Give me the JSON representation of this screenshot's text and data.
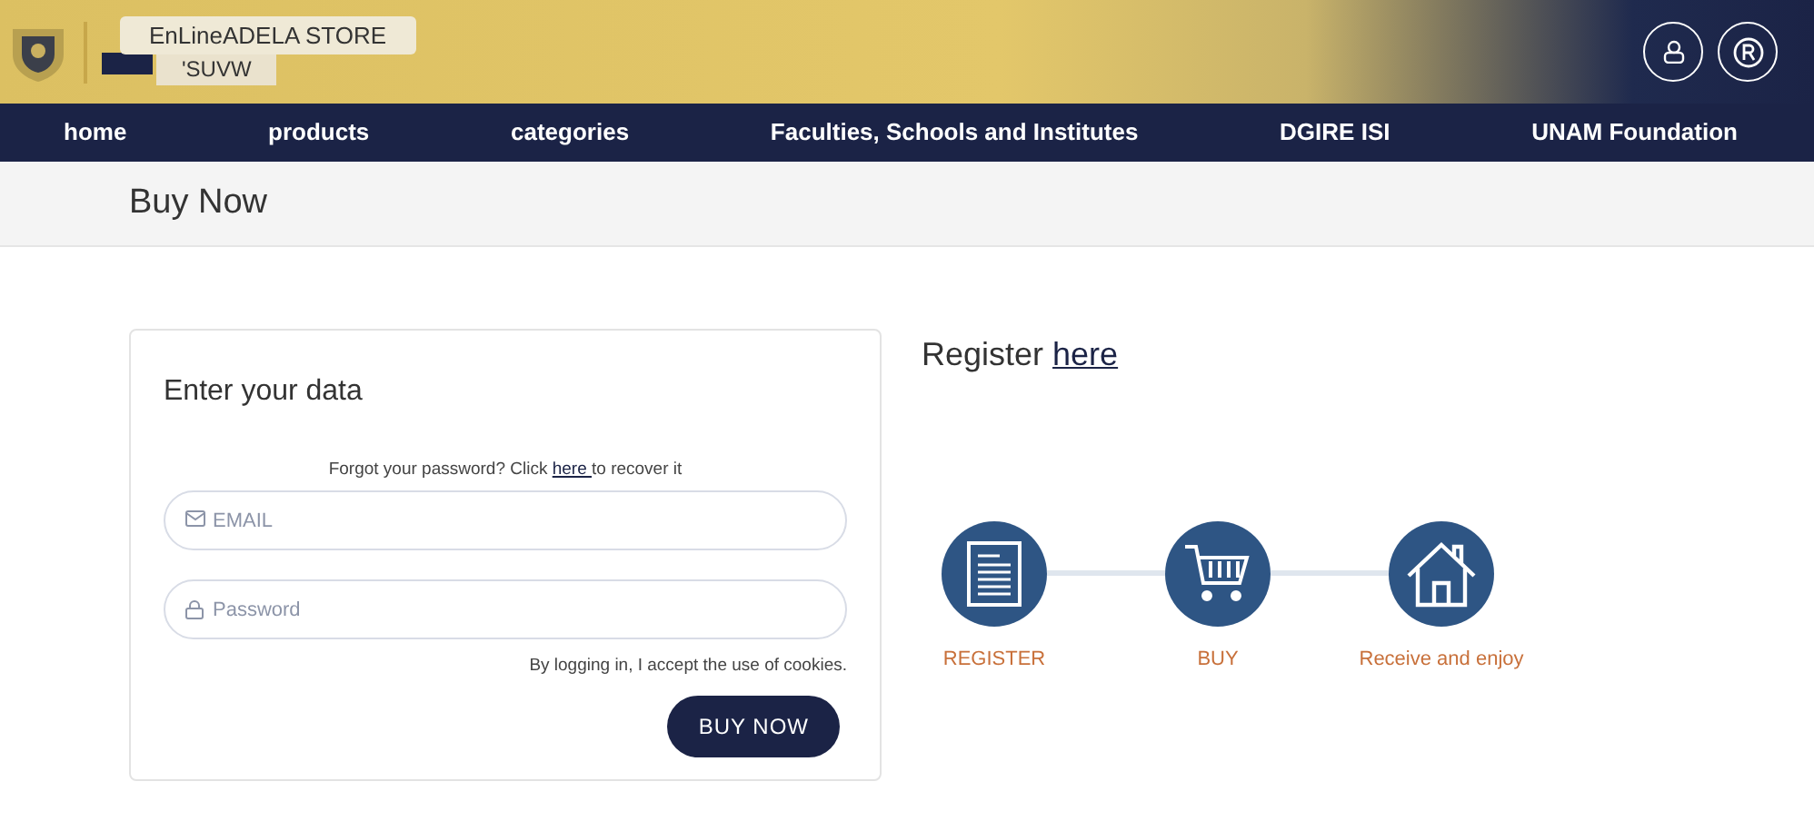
{
  "header": {
    "store_label": "EnLineADELA STORE",
    "mirrored_label": "'SUVW"
  },
  "nav": [
    {
      "label": "home"
    },
    {
      "label": "products"
    },
    {
      "label": "categories"
    },
    {
      "label": "Faculties, Schools and Institutes"
    },
    {
      "label": "DGIRE ISI"
    },
    {
      "label": "UNAM Foundation"
    }
  ],
  "page_title": "Buy Now",
  "login": {
    "title": "Enter your data",
    "forgot_before": "Forgot your password? Click ",
    "forgot_link": "here ",
    "forgot_after": "to recover it",
    "fields": [
      {
        "kind": "email",
        "placeholder": "EMAIL"
      },
      {
        "kind": "password",
        "placeholder": "Password"
      }
    ],
    "cookies_note": "By logging in, I accept the use of cookies.",
    "button": "BUY NOW"
  },
  "register": {
    "text": "Register ",
    "link": "here"
  },
  "steps": [
    {
      "kind": "document",
      "label": "REGISTER"
    },
    {
      "kind": "cart",
      "label": "BUY"
    },
    {
      "kind": "house",
      "label": "Receive and enjoy"
    }
  ]
}
